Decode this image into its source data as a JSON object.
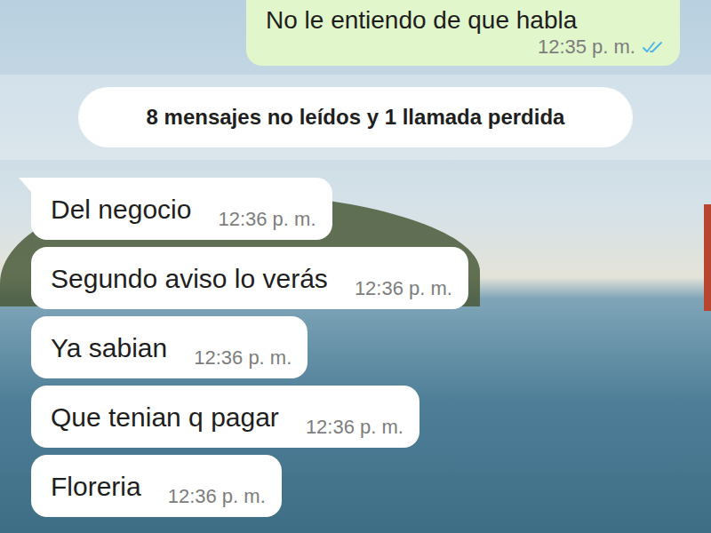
{
  "outgoing": {
    "text": "No le entiendo de que habla",
    "time": "12:35 p. m.",
    "read": true
  },
  "unread_banner": {
    "text": "8 mensajes no leídos y 1 llamada perdida"
  },
  "messages": [
    {
      "text": "Del negocio",
      "time": "12:36 p. m."
    },
    {
      "text": "Segundo aviso lo verás",
      "time": "12:36 p. m."
    },
    {
      "text": "Ya sabian",
      "time": "12:36 p. m."
    },
    {
      "text": "Que tenian q pagar",
      "time": "12:36 p. m."
    },
    {
      "text": "Floreria",
      "time": "12:36 p. m."
    }
  ]
}
